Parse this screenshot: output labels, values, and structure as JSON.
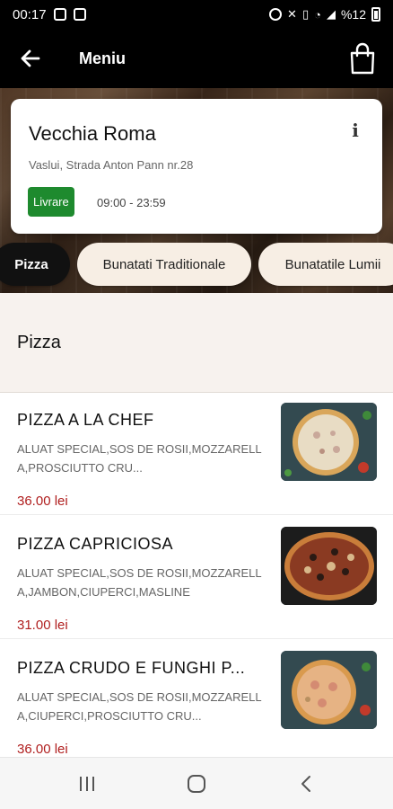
{
  "status_bar": {
    "time": "00:17",
    "battery": "%12",
    "icons": [
      "instagram-icon",
      "image-icon",
      "alarm-icon",
      "mute-icon",
      "volte-icon",
      "wifi-icon",
      "signal-icon",
      "battery-icon"
    ]
  },
  "app_bar": {
    "title": "Meniu",
    "back_icon": "arrow-left-icon",
    "cart_icon": "shopping-bag-icon"
  },
  "restaurant": {
    "name": "Vecchia Roma",
    "address": "Vaslui, Strada Anton Pann nr.28",
    "delivery_badge": "Livrare",
    "hours": "09:00 - 23:59",
    "info_icon": "info-icon"
  },
  "categories": [
    {
      "label": "Pizza",
      "active": true
    },
    {
      "label": "Bunatati Traditionale",
      "active": false
    },
    {
      "label": "Bunatatile Lumii",
      "active": false
    }
  ],
  "section": {
    "title": "Pizza"
  },
  "products": [
    {
      "name": "PIZZA A LA CHEF",
      "description": "ALUAT SPECIAL,SOS DE ROSII,MOZZARELLA,PROSCIUTTO CRU...",
      "price": "36.00 lei"
    },
    {
      "name": "PIZZA CAPRICIOSA",
      "description": "ALUAT SPECIAL,SOS DE ROSII,MOZZARELLA,JAMBON,CIUPERCI,MASLINE",
      "price": "31.00 lei"
    },
    {
      "name": "PIZZA CRUDO E FUNGHI P...",
      "description": "ALUAT SPECIAL,SOS DE ROSII,MOZZARELLA,CIUPERCI,PROSCIUTTO CRU...",
      "price": "36.00 lei"
    }
  ],
  "nav_bar": {
    "icons": [
      "recent-apps-icon",
      "home-icon",
      "back-nav-icon"
    ]
  },
  "colors": {
    "app_bar": "#000000",
    "delivery_badge": "#1e8a2e",
    "price": "#b01e1e",
    "chip": "#f7eee4",
    "section_bg": "#f7f2ee"
  }
}
